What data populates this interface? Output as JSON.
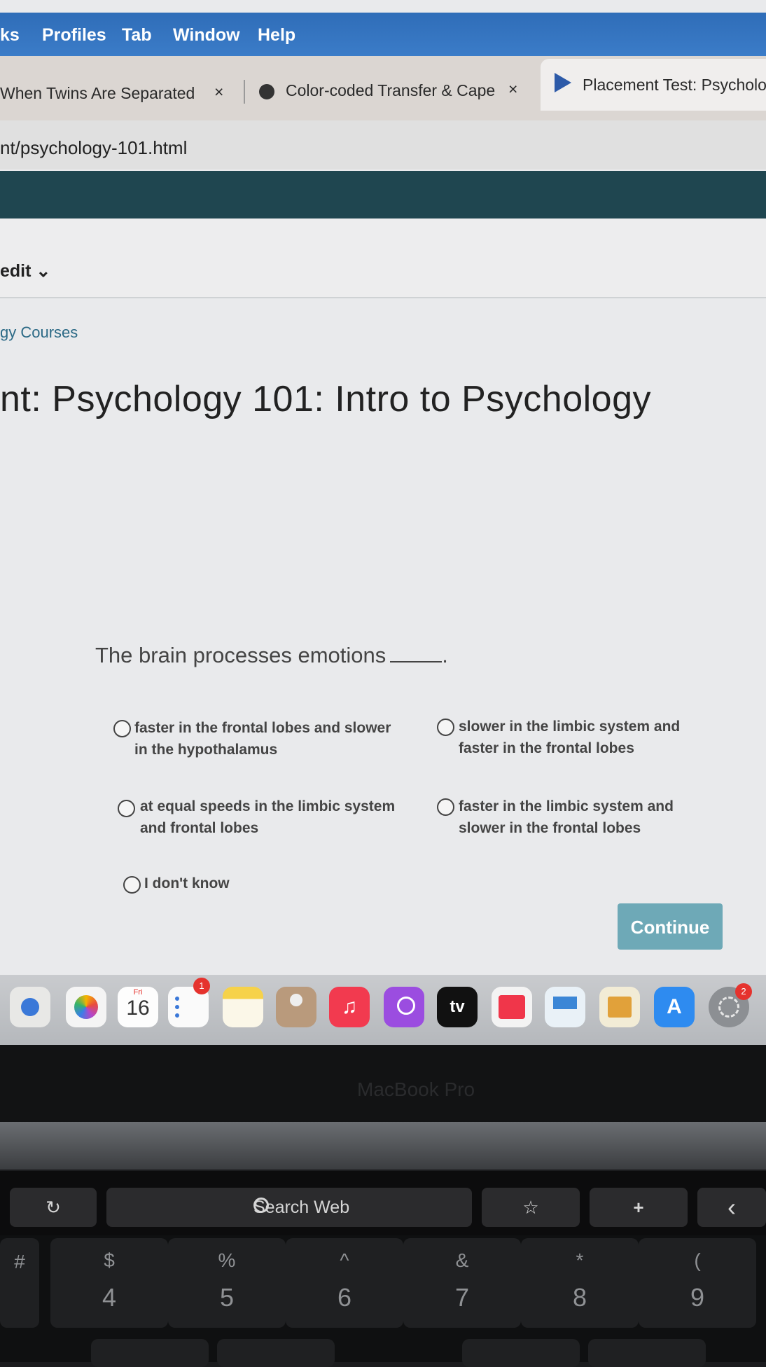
{
  "menubar": {
    "items": [
      "ks",
      "Profiles",
      "Tab",
      "Window",
      "Help"
    ]
  },
  "tabs": [
    {
      "label": "When Twins Are Separated",
      "close": "×"
    },
    {
      "label": "Color-coded Transfer & Cape",
      "close": "×"
    },
    {
      "label": "Placement Test: Psycholog"
    }
  ],
  "address": {
    "url": "nt/psychology-101.html"
  },
  "subnav": {
    "edit_label": "edit ⌄",
    "breadcrumb": "gy Courses"
  },
  "page": {
    "title": "nt: Psychology 101: Intro to Psychology"
  },
  "question": {
    "text": "The brain processes emotions",
    "end": ".",
    "options": [
      {
        "line1": "faster in the frontal lobes and slower",
        "line2": "in the hypothalamus"
      },
      {
        "line1": "slower in the limbic system and",
        "line2": "faster in the frontal lobes"
      },
      {
        "line1": "at equal speeds in the limbic system",
        "line2": "and frontal lobes"
      },
      {
        "line1": "faster in the limbic system and",
        "line2": "slower in the frontal lobes"
      },
      {
        "line1": "I don't know",
        "line2": ""
      }
    ],
    "continue_label": "Continue"
  },
  "dock": {
    "calendar_day": "Fri",
    "calendar_date": "16",
    "reminders_badge": "1",
    "settings_badge": "2",
    "tv_label": "tv"
  },
  "laptop": {
    "brand": "MacBook Pro"
  },
  "touchbar": {
    "search_label": "Search Web",
    "refresh": "↻",
    "star": "☆",
    "add": "+",
    "back": "‹"
  },
  "keys": [
    {
      "top": "",
      "bot": "#"
    },
    {
      "top": "$",
      "bot": "4"
    },
    {
      "top": "%",
      "bot": "5"
    },
    {
      "top": "^",
      "bot": "6"
    },
    {
      "top": "&",
      "bot": "7"
    },
    {
      "top": "*",
      "bot": "8"
    },
    {
      "top": "(",
      "bot": "9"
    }
  ],
  "colors": {
    "menubar": "#3b7cc8",
    "nav_band": "#1f4650",
    "continue_button": "#6ea9b7",
    "link": "#2c6a86"
  }
}
